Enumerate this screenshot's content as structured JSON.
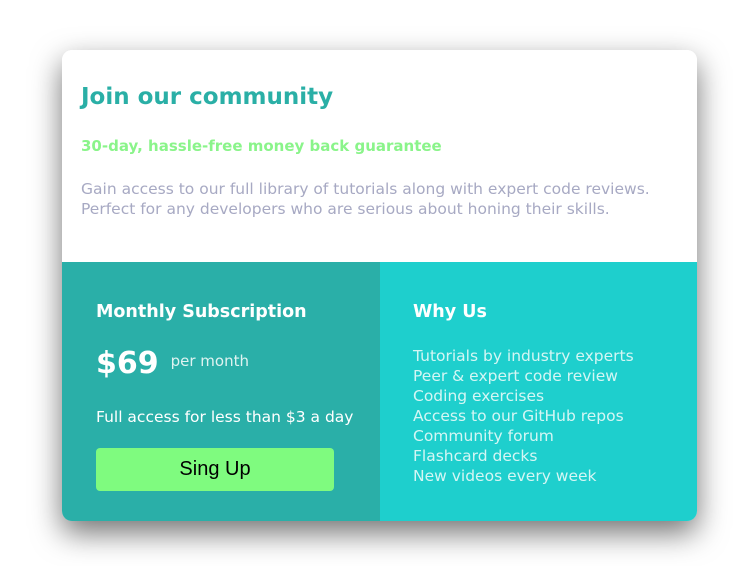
{
  "header": {
    "title": "Join our community",
    "guarantee": "30-day, hassle-free money back guarantee",
    "description_lines": [
      "Gain access to our full library of tutorials along with expert code reviews.",
      "Perfect for any developers who are serious about honing their skills."
    ]
  },
  "subscription": {
    "title": "Monthly Subscription",
    "price": "$69",
    "period": "per month",
    "access_note": "Full access for less than $3 a day",
    "button_label": "Sing Up"
  },
  "why_us": {
    "title": "Why Us",
    "items": [
      "Tutorials by industry experts",
      "Peer & expert code review",
      "Coding exercises",
      "Access to our GitHub repos",
      "Community forum",
      "Flashcard decks",
      "New videos every week"
    ]
  },
  "colors": {
    "title_teal": "#2aafa6",
    "guarantee_green": "#8af48a",
    "description_gray": "#a7a9c3",
    "left_panel": "#2aafa8",
    "right_panel": "#1ecfcd",
    "button_green": "#7ffb7f"
  }
}
